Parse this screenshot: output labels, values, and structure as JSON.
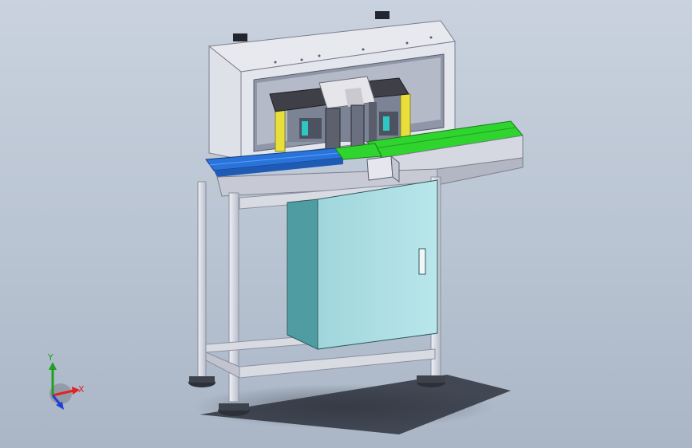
{
  "viewport": {
    "background_top": "#c9d2de",
    "background_bottom": "#aab6c6"
  },
  "triad": {
    "x_label": "X",
    "y_label": "Y",
    "x_color": "#e02424",
    "y_color": "#1fa01f",
    "z_color": "#1f3fd6"
  },
  "colors": {
    "frame": "#d9dbe3",
    "frame_shadow": "#9ea3b3",
    "cabinet_front": "#a9dbe0",
    "cabinet_side": "#4f9da3",
    "conveyor_green": "#2fd42f",
    "conveyor_blue": "#2a73d9",
    "mechanism_dark": "#3f4047",
    "actuator_yellow": "#e9df3c"
  }
}
